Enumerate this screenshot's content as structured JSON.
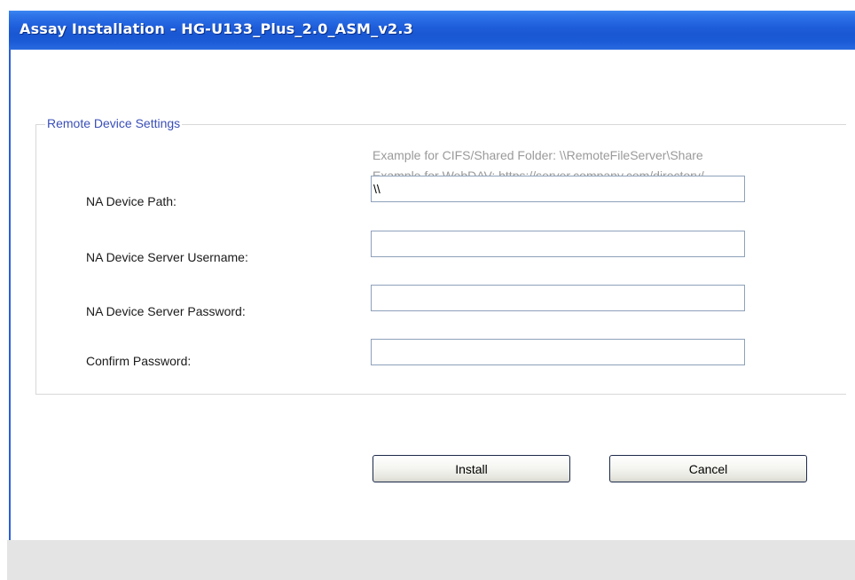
{
  "window": {
    "title": "Assay Installation - HG-U133_Plus_2.0_ASM_v2.3"
  },
  "group": {
    "legend": "Remote Device Settings",
    "hints": {
      "cifs": "Example for CIFS/Shared Folder: \\\\RemoteFileServer\\Share",
      "webdav": "Example for WebDAV: https://server.company.com/directory/"
    },
    "fields": {
      "device_path": {
        "label": "NA Device Path:",
        "value": "\\\\"
      },
      "username": {
        "label": "NA Device Server Username:",
        "value": ""
      },
      "password": {
        "label": "NA Device Server Password:",
        "value": ""
      },
      "confirm_password": {
        "label": "Confirm Password:",
        "value": ""
      }
    }
  },
  "buttons": {
    "install": "Install",
    "cancel": "Cancel"
  },
  "colors": {
    "titlebar": "#1f5fdc",
    "legend_text": "#3a4fb8",
    "hint_text": "#9a9a9a",
    "status_bar": "#e4e4e4"
  }
}
